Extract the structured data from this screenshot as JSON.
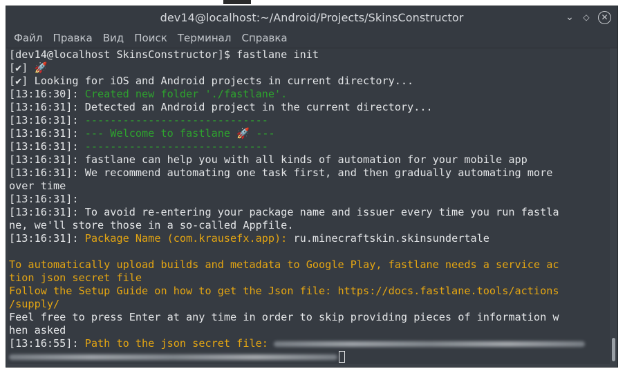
{
  "window": {
    "title": "dev14@localhost:~/Android/Projects/SkinsConstructor"
  },
  "menu": [
    "Файл",
    "Правка",
    "Вид",
    "Поиск",
    "Терминал",
    "Справка"
  ],
  "terminal": {
    "lines": [
      [
        {
          "t": "[dev14@localhost SkinsConstructor]$ fastlane init",
          "c": "w"
        }
      ],
      [
        {
          "t": "[✔] 🚀",
          "c": "w"
        }
      ],
      [
        {
          "t": "[✔] Looking for iOS and Android projects in current directory...",
          "c": "w"
        }
      ],
      [
        {
          "t": "[13:16:30]: ",
          "c": "w"
        },
        {
          "t": "Created new folder './fastlane'.",
          "c": "g"
        }
      ],
      [
        {
          "t": "[13:16:31]: Detected an Android project in the current directory...",
          "c": "w"
        }
      ],
      [
        {
          "t": "[13:16:31]: ",
          "c": "w"
        },
        {
          "t": "-----------------------------",
          "c": "g"
        }
      ],
      [
        {
          "t": "[13:16:31]: ",
          "c": "w"
        },
        {
          "t": "--- Welcome to fastlane 🚀 ---",
          "c": "g"
        }
      ],
      [
        {
          "t": "[13:16:31]: ",
          "c": "w"
        },
        {
          "t": "-----------------------------",
          "c": "g"
        }
      ],
      [
        {
          "t": "[13:16:31]: fastlane can help you with all kinds of automation for your mobile app",
          "c": "w"
        }
      ],
      [
        {
          "t": "[13:16:31]: We recommend automating one task first, and then gradually automating more",
          "c": "w"
        }
      ],
      [
        {
          "t": "over time",
          "c": "w"
        }
      ],
      [
        {
          "t": "[13:16:31]:",
          "c": "w"
        }
      ],
      [
        {
          "t": "[13:16:31]: To avoid re-entering your package name and issuer every time you run fastla",
          "c": "w"
        }
      ],
      [
        {
          "t": "ne, we'll store those in a so-called Appfile.",
          "c": "w"
        }
      ],
      [
        {
          "t": "[13:16:31]: ",
          "c": "w"
        },
        {
          "t": "Package Name (com.krausefx.app):",
          "c": "y"
        },
        {
          "t": " ru.minecraftskin.skinsundertale",
          "c": "w"
        }
      ],
      [
        {
          "t": "",
          "c": "w"
        }
      ],
      [
        {
          "t": "To automatically upload builds and metadata to Google Play, fastlane needs a service ac",
          "c": "y"
        }
      ],
      [
        {
          "t": "tion json secret file",
          "c": "y"
        }
      ],
      [
        {
          "t": "Follow the Setup Guide on how to get the Json file: https://docs.fastlane.tools/actions",
          "c": "y"
        }
      ],
      [
        {
          "t": "/supply/",
          "c": "y"
        }
      ],
      [
        {
          "t": "Feel free to press Enter at any time in order to skip providing pieces of information w",
          "c": "w"
        }
      ],
      [
        {
          "t": "hen asked",
          "c": "w"
        }
      ],
      [
        {
          "t": "[13:16:55]: ",
          "c": "w"
        },
        {
          "t": "Path to the json secret file:",
          "c": "y"
        }
      ]
    ]
  }
}
